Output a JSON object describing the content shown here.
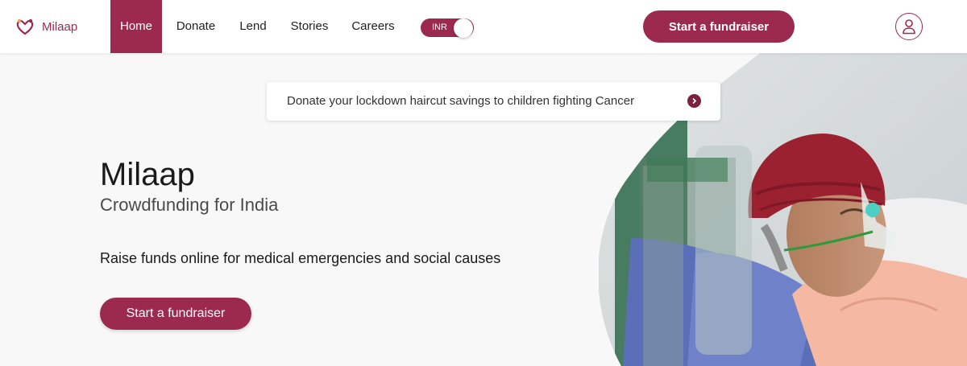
{
  "brand": {
    "name": "Milaap",
    "color": "#9c2a4e",
    "icon": "milaap-logo-icon"
  },
  "nav": {
    "items": [
      {
        "label": "Home",
        "active": true
      },
      {
        "label": "Donate",
        "active": false
      },
      {
        "label": "Lend",
        "active": false
      },
      {
        "label": "Stories",
        "active": false
      },
      {
        "label": "Careers",
        "active": false
      }
    ],
    "currency": "INR",
    "cta_label": "Start a fundraiser",
    "account_icon": "user-icon"
  },
  "banner": {
    "text": "Donate your lockdown haircut savings to children fighting Cancer",
    "icon": "chevron-right-icon"
  },
  "hero": {
    "title": "Milaap",
    "subtitle": "Crowdfunding for India",
    "description": "Raise funds online for medical emergencies and social causes",
    "cta_label": "Start a fundraiser"
  }
}
